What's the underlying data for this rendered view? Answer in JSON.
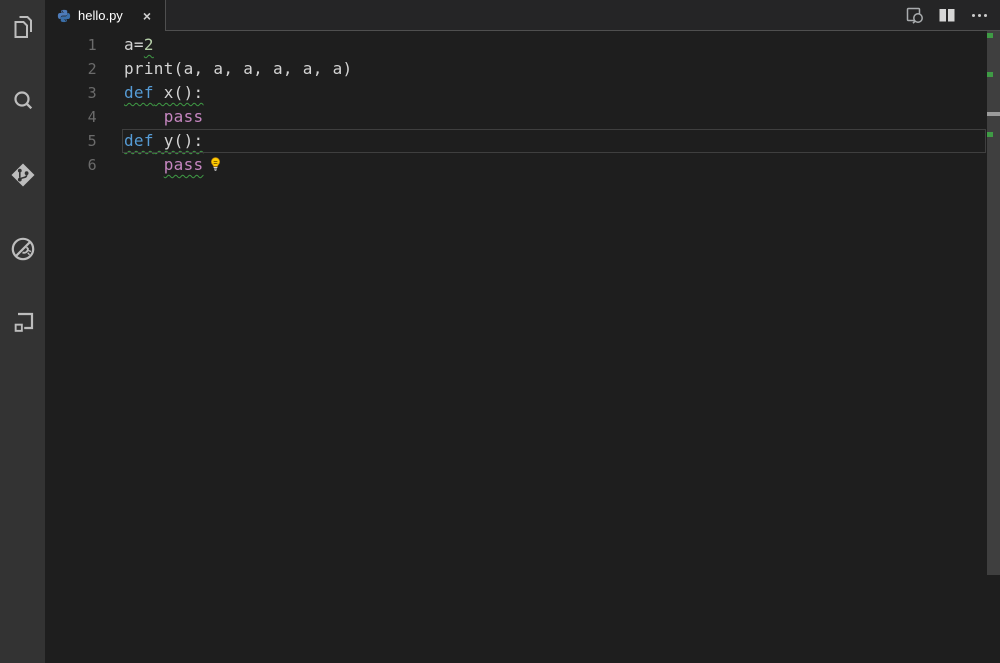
{
  "window": {
    "app": "Visual Studio Code"
  },
  "activity_bar": {
    "items": [
      {
        "label": "Explorer"
      },
      {
        "label": "Search"
      },
      {
        "label": "Source Control"
      },
      {
        "label": "Debug"
      },
      {
        "label": "Extensions"
      }
    ]
  },
  "tab": {
    "title": "hello.py",
    "close_glyph": "×",
    "icon": "python-icon"
  },
  "editor_actions": {
    "open_preview": "Open Preview",
    "split_editor": "Split Editor",
    "more_actions": "More Actions"
  },
  "editor": {
    "language": "python",
    "lines": [
      {
        "num": "1",
        "current": false,
        "lightbulb": false,
        "segments": [
          {
            "squiggle": false,
            "tokens": [
              {
                "text": "a=",
                "cl": "plain"
              }
            ]
          },
          {
            "squiggle": true,
            "tokens": [
              {
                "text": "2",
                "cl": "num"
              }
            ]
          }
        ]
      },
      {
        "num": "2",
        "current": false,
        "lightbulb": false,
        "segments": [
          {
            "squiggle": false,
            "tokens": [
              {
                "text": "print(a, a, a, a, a, a)",
                "cl": "plain"
              }
            ]
          }
        ]
      },
      {
        "num": "3",
        "current": false,
        "lightbulb": false,
        "segments": [
          {
            "squiggle": true,
            "tokens": [
              {
                "text": "def",
                "cl": "kw"
              },
              {
                "text": " x():",
                "cl": "plain"
              }
            ]
          }
        ]
      },
      {
        "num": "4",
        "current": false,
        "lightbulb": false,
        "segments": [
          {
            "squiggle": false,
            "tokens": [
              {
                "text": "    ",
                "cl": "plain"
              },
              {
                "text": "pass",
                "cl": "ctrl"
              }
            ]
          }
        ]
      },
      {
        "num": "5",
        "current": true,
        "lightbulb": false,
        "segments": [
          {
            "squiggle": true,
            "tokens": [
              {
                "text": "def",
                "cl": "kw"
              },
              {
                "text": " y():",
                "cl": "plain"
              }
            ]
          }
        ]
      },
      {
        "num": "6",
        "current": false,
        "lightbulb": true,
        "segments": [
          {
            "squiggle": false,
            "tokens": [
              {
                "text": "    ",
                "cl": "plain"
              }
            ]
          },
          {
            "squiggle": true,
            "tokens": [
              {
                "text": "pass",
                "cl": "ctrl"
              }
            ]
          }
        ]
      }
    ]
  },
  "colors": {
    "editor_bg": "#1e1e1e",
    "activity_bar_bg": "#333333",
    "tabbar_rest_bg": "#252526",
    "keyword": "#569cd6",
    "control_keyword": "#c586c0",
    "number_literal": "#b5cea8",
    "default_text": "#d4d4d4",
    "line_number": "#6b6b6b",
    "warning_squiggle": "#3f9b45",
    "current_line_border": "#3f3f3f",
    "scrollbar_slider": "#3f3f3f",
    "lightbulb": "#ffcc00",
    "python_icon_blue": "#4877b2"
  }
}
